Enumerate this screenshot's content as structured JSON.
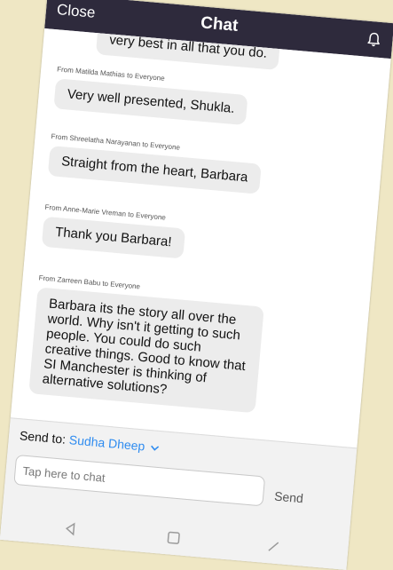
{
  "header": {
    "close_label": "Close",
    "title": "Chat",
    "bell_icon": "bell-icon"
  },
  "messages": [
    {
      "sender": "",
      "text": "very best in all that you do."
    },
    {
      "sender": "From Matilda Mathias to Everyone",
      "text": "Very well presented, Shukla."
    },
    {
      "sender": "From Shreelatha Narayanan to Everyone",
      "text": "Straight from the heart, Barbara"
    },
    {
      "sender": "From Anne-Marie Vreman to Everyone",
      "text": "Thank you Barbara!"
    },
    {
      "sender": "From Zarreen Babu to Everyone",
      "text": "Barbara its the story all over the world. Why isn't it getting to such people. You could do such creative things. Good to know that SI Manchester is thinking of alternative solutions?"
    }
  ],
  "footer": {
    "send_to_label": "Send to:",
    "recipient": "Sudha Dheep",
    "input_placeholder": "Tap here to chat",
    "input_value": "",
    "send_label": "Send"
  },
  "colors": {
    "header_bg": "#2e2a3c",
    "accent": "#2f8cf0",
    "bubble_bg": "#ececec",
    "background": "#efe7c4"
  },
  "nav_icons": [
    "back-icon",
    "home-icon",
    "recents-icon"
  ]
}
